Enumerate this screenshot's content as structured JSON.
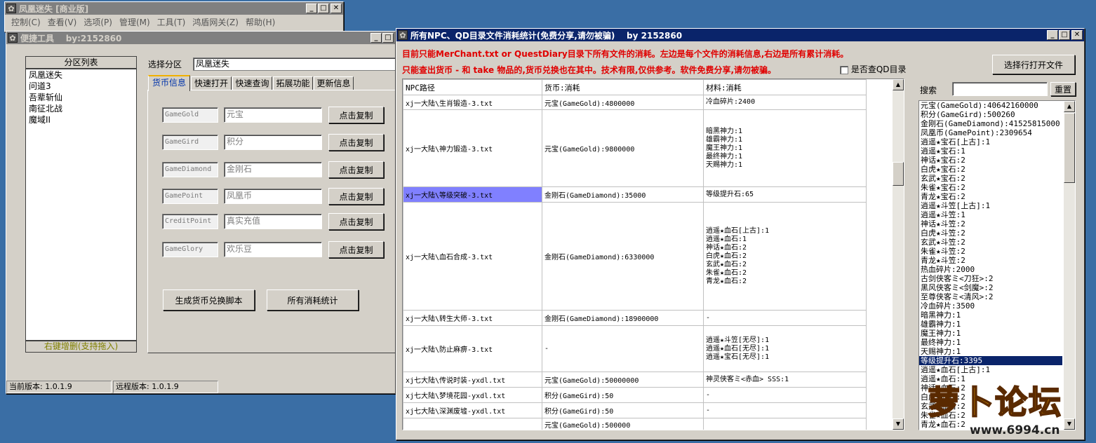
{
  "main_window": {
    "title": "凤凰迷失 [商业版]",
    "menu": [
      "控制(C)",
      "查看(V)",
      "选项(P)",
      "管理(M)",
      "工具(T)",
      "鸿盾网关(Z)",
      "帮助(H)"
    ]
  },
  "tool_window": {
    "title": "便捷工具    by:2152860",
    "zone_list_header": "分区列表",
    "zones": [
      "凤凰迷失",
      "问道3",
      "吾辈斩仙",
      "南征北战",
      "魔域II"
    ],
    "zone_list_footer": "右键增删(支持拖入)",
    "select_zone_label": "选择分区",
    "selected_zone": "凤凰迷失",
    "tabs": [
      "货币信息",
      "快速打开",
      "快速查询",
      "拓展功能",
      "更新信息"
    ],
    "currencies": [
      {
        "code": "GameGold",
        "name": "元宝",
        "button": "点击复制"
      },
      {
        "code": "GameGird",
        "name": "积分",
        "button": "点击复制"
      },
      {
        "code": "GameDiamond",
        "name": "金刚石",
        "button": "点击复制"
      },
      {
        "code": "GamePoint",
        "name": "凤凰币",
        "button": "点击复制"
      },
      {
        "code": "CreditPoint",
        "name": "真实充值",
        "button": "点击复制"
      },
      {
        "code": "GameGlory",
        "name": "欢乐豆",
        "button": "点击复制"
      }
    ],
    "generate_button": "生成货币兑换脚本",
    "stats_button": "所有消耗统计",
    "status_current": "当前版本: 1.0.1.9",
    "status_remote": "远程版本: 1.0.1.9"
  },
  "stats_window": {
    "title": "所有NPC、QD目录文件消耗统计(免费分享,请勿被骗)    by 2152860",
    "notice1": "目前只能MerChant.txt or QuestDiary目录下所有文件的消耗。左边是每个文件的消耗信息,右边是所有累计消耗。",
    "notice2": "只能查出货币 - 和 take 物品的,货币兑换也在其中。技术有限,仅供参考。软件免费分享,请勿被骗。",
    "checkbox_label": "是否查QD目录",
    "open_file_button": "选择行打开文件",
    "search_label": "搜索",
    "reset_button": "重置",
    "columns": [
      "NPC路径",
      "货币:消耗",
      "材料:消耗"
    ],
    "rows": [
      {
        "path": "xj一大陆\\生肖锻造-3.txt",
        "currency": "元宝(GameGold):4800000",
        "materials": [
          "冷血碎片:2400"
        ]
      },
      {
        "path": "xj一大陆\\神力锻造-3.txt",
        "currency": "元宝(GameGold):9800000",
        "materials": [
          "暗黑神力:1",
          "雄霸神力:1",
          "魔王神力:1",
          "最终神力:1",
          "天赐神力:1"
        ]
      },
      {
        "path": "xj一大陆\\等级突破-3.txt",
        "currency": "金刚石(GameDiamond):35000",
        "materials": [
          "等级提升石:65"
        ]
      },
      {
        "path": "xj一大陆\\血石合成-3.txt",
        "currency": "金刚石(GameDiamond):6330000",
        "materials": [
          "逍遥★血石[上古]:1",
          "逍遥★血石:1",
          "神话★血石:2",
          "白虎★血石:2",
          "玄武★血石:2",
          "朱雀★血石:2",
          "青龙★血石:2"
        ]
      },
      {
        "path": "xj一大陆\\转生大师-3.txt",
        "currency": "金刚石(GameDiamond):18900000",
        "materials": [
          "-"
        ]
      },
      {
        "path": "xj一大陆\\防止麻痹-3.txt",
        "currency": "-",
        "materials": [
          "逍遥★斗笠[无尽]:1",
          "逍遥★血石[无尽]:1",
          "逍遥★宝石[无尽]:1"
        ]
      },
      {
        "path": "xj七大陆\\传说时装-yxdl.txt",
        "currency": "元宝(GameGold):50000000",
        "materials": [
          "神灵侠客ミ<赤血> SSS:1"
        ]
      },
      {
        "path": "xj七大陆\\梦境花园-yxdl.txt",
        "currency": "积分(GameGird):50",
        "materials": [
          "-"
        ]
      },
      {
        "path": "xj七大陆\\深渊废墟-yxdl.txt",
        "currency": "积分(GameGird):50",
        "materials": [
          "-"
        ]
      },
      {
        "path": "",
        "currency": "元宝(GameGold):500000",
        "materials": [
          ""
        ]
      }
    ],
    "totals": [
      "元宝(GameGold):40642160000",
      "积分(GameGird):500260",
      "金刚石(GameDiamond):41525815000",
      "凤凰币(GamePoint):2309654",
      "逍遥★宝石[上古]:1",
      "逍遥★宝石:1",
      "神话★宝石:2",
      "白虎★宝石:2",
      "玄武★宝石:2",
      "朱雀★宝石:2",
      "青龙★宝石:2",
      "逍遥★斗笠[上古]:1",
      "逍遥★斗笠:1",
      "神话★斗笠:2",
      "白虎★斗笠:2",
      "玄武★斗笠:2",
      "朱雀★斗笠:2",
      "青龙★斗笠:2",
      "热血碎片:2000",
      "古剑侠客ミ<刀狂>:2",
      "黑风侠客ミ<剑魔>:2",
      "至尊侠客ミ<清风>:2",
      "冷血碎片:3500",
      "暗黑神力:1",
      "雄霸神力:1",
      "魔王神力:1",
      "最终神力:1",
      "天赐神力:1",
      "等级提升石:3395",
      "逍遥★血石[上古]:1",
      "逍遥★血石:1",
      "神话★血石:2",
      "白虎★血石:2",
      "玄武★血石:2",
      "朱雀★血石:2",
      "青龙★血石:2"
    ],
    "highlighted_total_index": 28
  },
  "watermark": {
    "text": "萝卜论坛",
    "url": "www.6994.cn"
  }
}
